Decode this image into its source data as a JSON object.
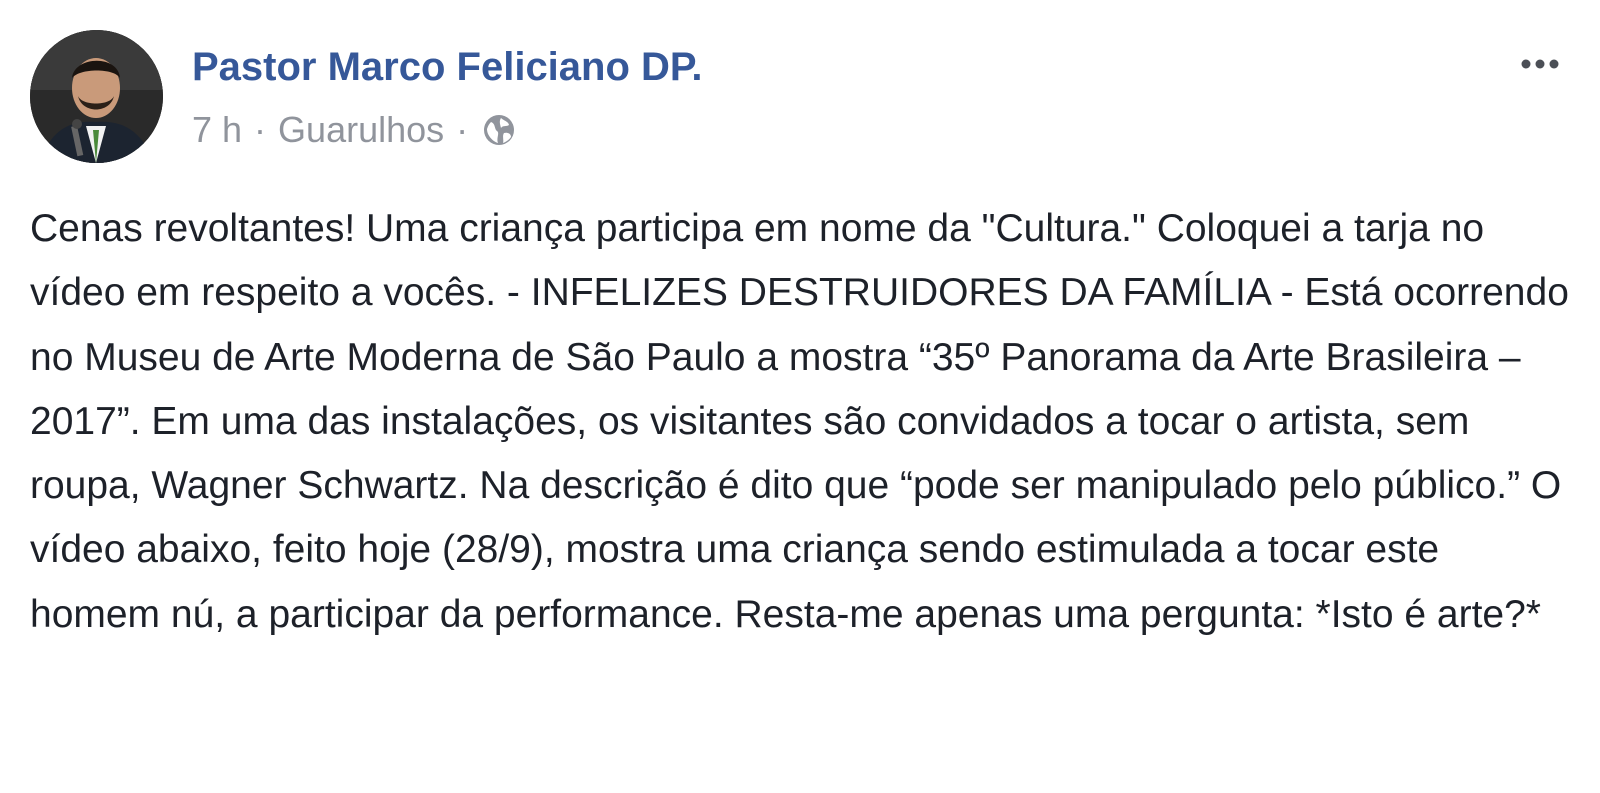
{
  "post": {
    "author_name": "Pastor Marco Feliciano DP.",
    "timestamp": "7 h",
    "separator": "·",
    "location": "Guarulhos",
    "privacy_icon": "globe-icon",
    "more_icon": "more-options-icon",
    "message": "Cenas revoltantes! Uma criança participa em nome da \"Cultura.\" Coloquei a tarja no vídeo em respeito a vocês. - INFELIZES DESTRUIDORES DA FAMÍLIA - Está ocorrendo no Museu de Arte Moderna de São Paulo a mostra “35º Panorama da Arte Brasileira – 2017”. Em uma das instalações, os visitantes são convidados a tocar o artista, sem roupa, Wagner Schwartz. Na descrição é dito que “pode ser manipulado pelo público.” O vídeo abaixo, feito hoje (28/9), mostra uma criança sendo estimulada a tocar este homem nú, a participar da performance. Resta-me apenas uma pergunta: *Isto é arte?*"
  },
  "colors": {
    "author_link": "#365899",
    "meta_text": "#90949c",
    "body_text": "#1d2129",
    "background": "#ffffff"
  }
}
